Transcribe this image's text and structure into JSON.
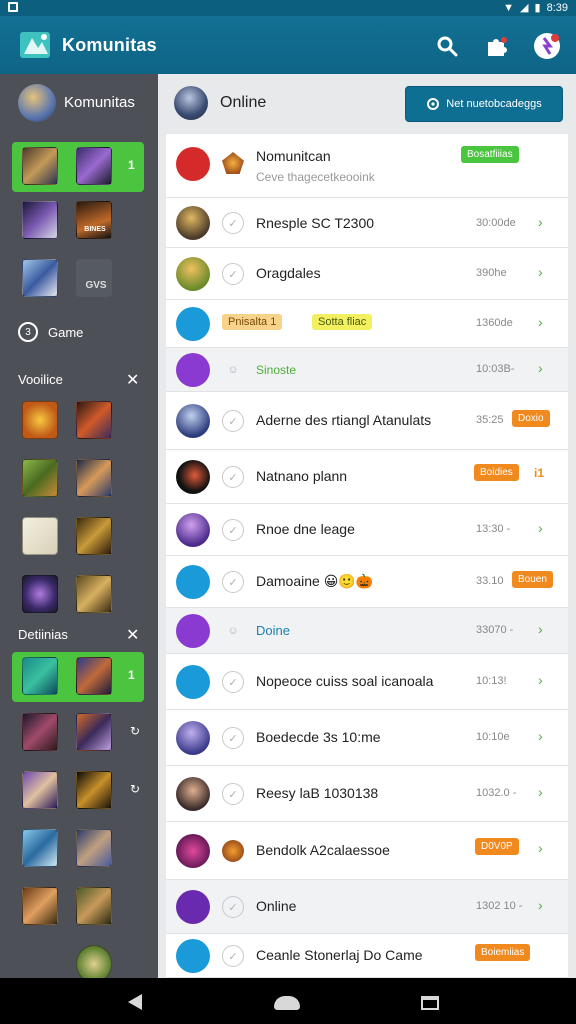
{
  "status_bar": {
    "time": "8:39"
  },
  "app": {
    "title": "Komunitas"
  },
  "sidebar": {
    "header": "Komunitas",
    "game_label": "Game",
    "section1": "Vooilice",
    "section2": "Detiinias",
    "active_count_1": "1",
    "active_count_2": "1",
    "thumb_caption_1": "BINES",
    "thumb_caption_2": "GVS"
  },
  "content": {
    "header_title": "Online",
    "new_button_label": "Net nuetobcadeggs"
  },
  "rows": [
    {
      "title": "Nomunitcan",
      "subtitle": "Ceve thagecetkeooink",
      "badge": "Bosatfiiias",
      "badge_color": "#4bc440"
    },
    {
      "title": "Rnesple SC T2300",
      "time": "30:00de"
    },
    {
      "title": "Oragdales",
      "time": "390he"
    },
    {
      "tag1": "Pnisalta 1",
      "tag2": "Sotta fliac",
      "time": "1360de"
    },
    {
      "title": "Sinoste",
      "time": "10:03B-",
      "style": "green"
    },
    {
      "title": "Aderne des rtiangl Atanulats",
      "time": "35:25",
      "badge": "Doxio"
    },
    {
      "title": "Natnano plann",
      "badge": "Boidies",
      "extra": "i1"
    },
    {
      "title": "Rnoe dne leage",
      "time": "13:30 -"
    },
    {
      "title": "Damoaine",
      "time": "33.10",
      "badge": "Bouen",
      "emoji": "😀🙂🎃"
    },
    {
      "title": "Doine",
      "time": "33070 -",
      "style": "blue"
    },
    {
      "title": "Nopeoce cuiss soal icanoala",
      "time": "10:13!"
    },
    {
      "title": "Boedecde 3s 10:me",
      "time": "10:10e"
    },
    {
      "title": "Reesy laB 1030138",
      "time": "1032.0 -"
    },
    {
      "title": "Bendolk A2calaessoe",
      "badge": "D0V0P"
    },
    {
      "title": "Online",
      "time": "1302 10 -"
    },
    {
      "title": "Ceanle Stonerlaj Do Came",
      "badge": "Boiemiias"
    }
  ],
  "colors": {
    "appbar": "#127194",
    "sidebar": "#4d5157",
    "accent_green": "#4bc440",
    "badge_orange": "#f0891e"
  }
}
